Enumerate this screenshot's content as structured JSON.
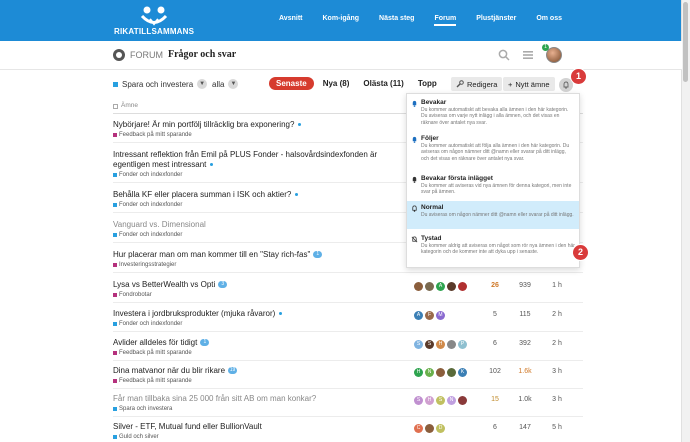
{
  "brand": {
    "logo_text": "RIKATILLSAMMANS",
    "accent": "#1d8bd6",
    "danger": "#d63b2e"
  },
  "nav": {
    "items": [
      {
        "label": "Avsnitt",
        "active": false
      },
      {
        "label": "Kom-igång",
        "active": false
      },
      {
        "label": "Nästa steg",
        "active": false
      },
      {
        "label": "Forum",
        "active": true
      },
      {
        "label": "Plustjänster",
        "active": false
      },
      {
        "label": "Om oss",
        "active": false
      }
    ]
  },
  "header": {
    "forum_label": "FORUM",
    "title": "Frågor och svar",
    "notification_count": "1"
  },
  "filters": {
    "category": "Spara och investera",
    "tag": "alla"
  },
  "tabs": [
    {
      "label": "Senaste",
      "active": true
    },
    {
      "label": "Nya (8)",
      "active": false
    },
    {
      "label": "Olästa (11)",
      "active": false
    },
    {
      "label": "Topp",
      "active": false
    }
  ],
  "actions": {
    "edit_label": "Redigera",
    "new_topic_label": "Nytt ämne"
  },
  "table_header": {
    "topic_col": "Ämne"
  },
  "markers": [
    "1",
    "2"
  ],
  "notification_menu": [
    {
      "title": "Bevakar",
      "desc": "Du kommer automatiskt att bevaka alla ämnen i den här kategorin. Du aviseras om varje nytt inlägg i alla ämnen, och det visas en räknare över antalet nya svar.",
      "icon": "bell-filled-icon",
      "selected": false
    },
    {
      "title": "Följer",
      "desc": "Du kommer automatiskt att följa alla ämnen i den här kategorin. Du aviseras om någon nämner ditt @namn eller svarar på ditt inlägg, och det visas en räknare över antalet nya svar.",
      "icon": "bell-filled-icon",
      "selected": false
    },
    {
      "title": "Bevakar första inlägget",
      "desc": "Du kommer att aviseras vid nya ämnen för denna kategori, men inte svar på ämnen.",
      "icon": "bell-filled-icon",
      "selected": false
    },
    {
      "title": "Normal",
      "desc": "Du aviseras om någon nämner ditt @namn eller svarar på ditt inlägg.",
      "icon": "bell-outline-icon",
      "selected": true
    },
    {
      "title": "Tystad",
      "desc": "Du kommer aldrig att aviseras om något som rör nya ämnen i den här kategorin och de kommer inte att dyka upp i senaste.",
      "icon": "bell-slash-icon",
      "selected": false
    }
  ],
  "topics": [
    {
      "title": "Nybörjare! Är min portfölj tillräcklig bra exponering?",
      "category": "Feedback på mitt sparande",
      "cat_color": "#b5317d",
      "new": true,
      "visited": false
    },
    {
      "title": "Intressant reflektion från Emil på PLUS Fonder - halsovårdsindexfonden är egentligen mest intressant",
      "category": "Fonder och indexfonder",
      "cat_color": "#28a0e0",
      "new": true,
      "visited": false
    },
    {
      "title": "Behålla KF eller placera summan i ISK och aktier?",
      "category": "Fonder och indexfonder",
      "cat_color": "#28a0e0",
      "new": true,
      "visited": false
    },
    {
      "title": "Vanguard vs. Dimensional",
      "category": "Fonder och indexfonder",
      "cat_color": "#28a0e0",
      "new": false,
      "visited": true
    },
    {
      "title": "Hur placerar man om man kommer till en \"Stay rich-fas\"",
      "category": "Investeringsstrategier",
      "cat_color": "#b5317d",
      "badge": "1",
      "visited": false
    },
    {
      "title": "Lysa vs BetterWealth vs Opti",
      "category": "Fondrobotar",
      "cat_color": "#b5317d",
      "badge": "3",
      "visited": false,
      "posters": [
        {
          "letter": "",
          "color": "#8b5e3c"
        },
        {
          "letter": "",
          "color": "#8b5e3c"
        },
        {
          "letter": "A",
          "color": "#2ea44f"
        },
        {
          "letter": "",
          "color": "#5a3a2a"
        },
        {
          "letter": "",
          "color": "#b03030"
        }
      ],
      "replies": "26",
      "views": "939",
      "activity": "1 h",
      "hot": true
    },
    {
      "title": "Investera i jordbruksprodukter (mjuka råvaror)",
      "category": "Fonder och indexfonder",
      "cat_color": "#28a0e0",
      "new": true,
      "visited": false,
      "posters": [
        {
          "letter": "A",
          "color": "#3b7fb5"
        },
        {
          "letter": "F",
          "color": "#9a6a4a"
        },
        {
          "letter": "M",
          "color": "#8a6ad0"
        }
      ],
      "replies": "5",
      "views": "115",
      "activity": "2 h"
    },
    {
      "title": "Avlider alldeles för tidigt",
      "category": "Feedback på mitt sparande",
      "cat_color": "#b5317d",
      "badge": "1",
      "visited": false,
      "posters": [
        {
          "letter": "S",
          "color": "#7fb3e0"
        },
        {
          "letter": "S",
          "color": "#5a3a2a"
        },
        {
          "letter": "H",
          "color": "#d08a4a"
        },
        {
          "letter": "",
          "color": "#888"
        },
        {
          "letter": "P",
          "color": "#8fc0d0"
        }
      ],
      "replies": "6",
      "views": "392",
      "activity": "2 h"
    },
    {
      "title": "Dina matvanor när du blir rikare",
      "category": "Feedback på mitt sparande",
      "cat_color": "#b5317d",
      "badge": "19",
      "visited": false,
      "posters": [
        {
          "letter": "H",
          "color": "#2ea44f"
        },
        {
          "letter": "N",
          "color": "#6ab04c"
        },
        {
          "letter": "",
          "color": "#8b5e3c"
        },
        {
          "letter": "",
          "color": "#5a6a3a"
        },
        {
          "letter": "K",
          "color": "#3b7fb5"
        }
      ],
      "replies": "102",
      "views": "1.6k",
      "activity": "3 h"
    },
    {
      "title": "Får man tillbaka sina 25 000 från sitt AB om man konkar?",
      "category": "Spara och investera",
      "cat_color": "#28a0e0",
      "visited": true,
      "posters": [
        {
          "letter": "S",
          "color": "#c090d0"
        },
        {
          "letter": "H",
          "color": "#d0a0d0"
        },
        {
          "letter": "S",
          "color": "#c0c060"
        },
        {
          "letter": "N",
          "color": "#c0a0e0"
        },
        {
          "letter": "",
          "color": "#8a3a3a"
        }
      ],
      "replies": "15",
      "views": "1.0k",
      "activity": "3 h"
    },
    {
      "title": "Silver - ETF, Mutual fund eller BullionVault",
      "category": "Guld och silver",
      "cat_color": "#28a0e0",
      "visited": false,
      "posters": [
        {
          "letter": "C",
          "color": "#e07050"
        },
        {
          "letter": "",
          "color": "#8b5e3c"
        },
        {
          "letter": "D",
          "color": "#c0c060"
        }
      ],
      "replies": "6",
      "views": "147",
      "activity": "5 h"
    }
  ]
}
